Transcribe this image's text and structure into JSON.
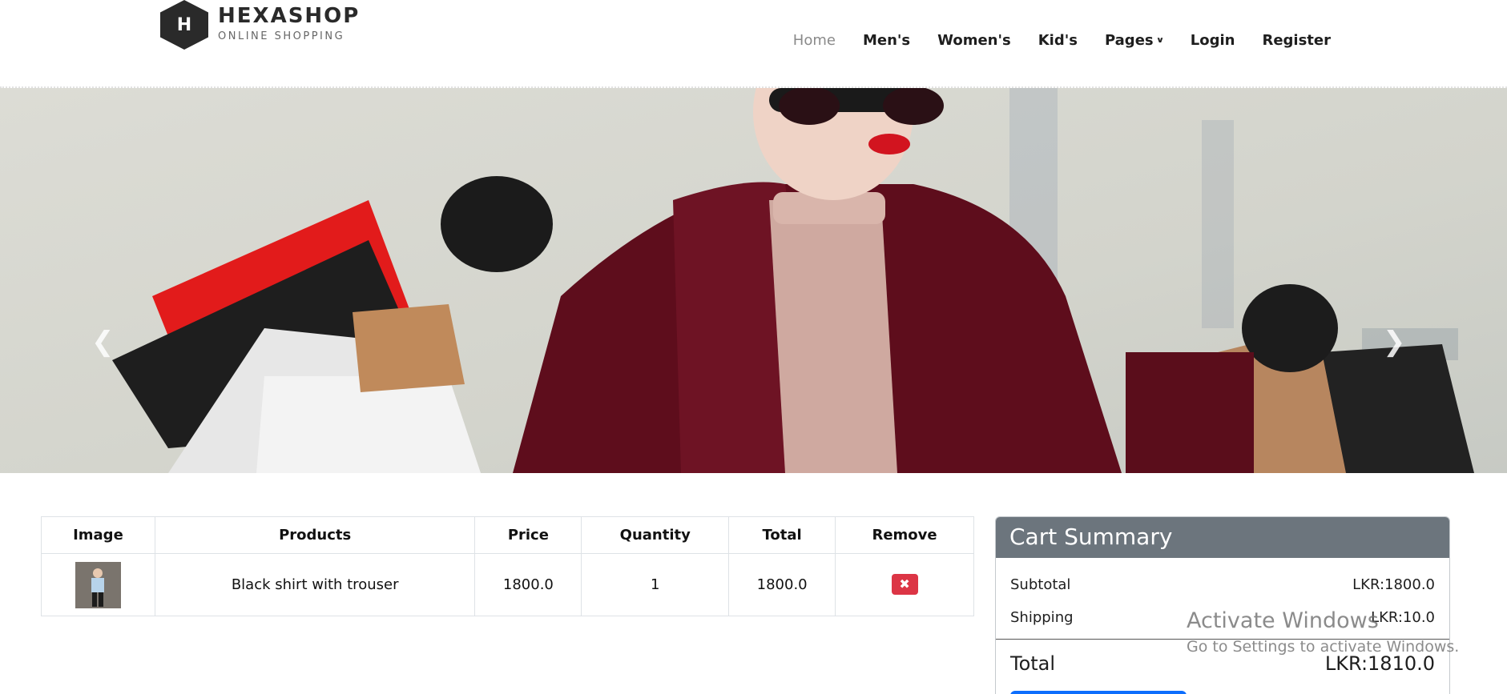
{
  "brand": {
    "logo_letter": "H",
    "title": "HEXASHOP",
    "subtitle": "ONLINE SHOPPING"
  },
  "nav": {
    "items": [
      {
        "label": "Home",
        "active": true
      },
      {
        "label": "Men's"
      },
      {
        "label": "Women's"
      },
      {
        "label": "Kid's"
      },
      {
        "label": "Pages",
        "has_dropdown": true
      },
      {
        "label": "Login"
      },
      {
        "label": "Register"
      }
    ]
  },
  "hero": {
    "prev_icon": "chevron-left-icon",
    "next_icon": "chevron-right-icon"
  },
  "cart": {
    "headers": [
      "Image",
      "Products",
      "Price",
      "Quantity",
      "Total",
      "Remove"
    ],
    "rows": [
      {
        "product": "Black shirt with trouser",
        "price": "1800.0",
        "quantity": "1",
        "total": "1800.0",
        "remove_icon": "close-icon"
      }
    ]
  },
  "summary": {
    "title": "Cart Summary",
    "subtotal_label": "Subtotal",
    "subtotal_value": "LKR:1800.0",
    "shipping_label": "Shipping",
    "shipping_value": "LKR:10.0",
    "total_label": "Total",
    "total_value": "LKR:1810.0"
  },
  "watermark": {
    "title": "Activate Windows",
    "subtitle": "Go to Settings to activate Windows."
  },
  "colors": {
    "summary_header": "#6c757d",
    "remove": "#dc3545",
    "primary": "#0d6efd",
    "nav_active": "#8a8a8a"
  }
}
